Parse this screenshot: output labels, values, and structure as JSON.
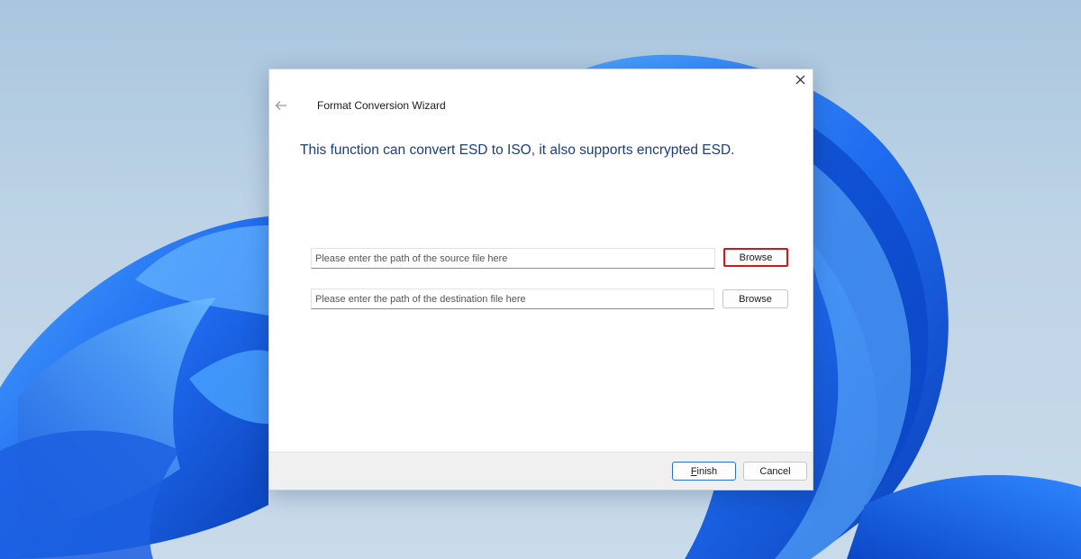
{
  "dialog": {
    "title": "Format Conversion Wizard",
    "instruction": "This function can convert ESD to ISO, it also supports encrypted ESD.",
    "back_icon": "back-arrow-icon",
    "close_icon": "close-icon"
  },
  "source": {
    "placeholder": "Please enter the path of the source file here",
    "value": "",
    "browse_label": "Browse"
  },
  "destination": {
    "placeholder": "Please enter the path of the destination file here",
    "value": "",
    "browse_label": "Browse"
  },
  "footer": {
    "finish_mnemonic": "F",
    "finish_rest": "inish",
    "cancel_label": "Cancel"
  },
  "colors": {
    "instruction_text": "#1b3f7a",
    "highlight_border": "#d41717",
    "default_button_border": "#2a6fc9",
    "wallpaper_bloom": "#1f6cf0"
  }
}
